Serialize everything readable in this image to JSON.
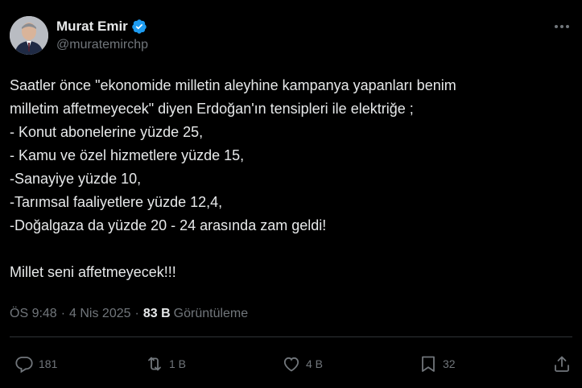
{
  "author": {
    "display_name": "Murat Emir",
    "handle": "@muratemirchp",
    "verified_icon": "verified-badge-icon",
    "avatar_icon": "profile-avatar"
  },
  "tweet": {
    "text": "Saatler önce \"ekonomide milletin aleyhine kampanya yapanları benim\nmilletim affetmeyecek\" diyen Erdoğan'ın tensipleri ile elektriğe ;\n- Konut abonelerine yüzde 25,\n- Kamu ve özel hizmetlere yüzde 15,\n-Sanayiye yüzde 10,\n-Tarımsal faaliyetlere yüzde 12,4,\n-Doğalgaza da yüzde 20 - 24 arasında zam geldi!\n\nMillet seni affetmeyecek!!!"
  },
  "meta": {
    "time": "ÖS 9:48",
    "date": "4 Nis 2025",
    "views_count": "83 B",
    "views_label": "Görüntüleme"
  },
  "actions": {
    "replies": "181",
    "reposts": "1 B",
    "likes": "4 B",
    "bookmarks": "32"
  },
  "colors": {
    "background": "#000000",
    "text": "#e7e9ea",
    "muted": "#71767b",
    "verified": "#1d9bf0",
    "divider": "#2f3336"
  }
}
